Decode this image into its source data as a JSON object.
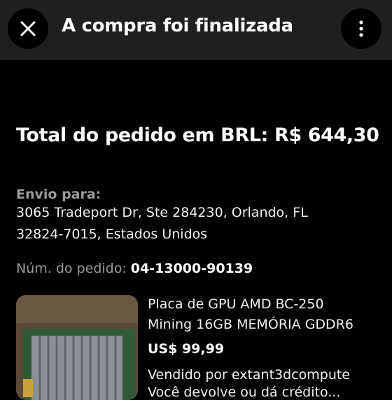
{
  "header": {
    "title": "A compra foi finalizada",
    "close_icon": "close-icon",
    "more_icon": "more-vertical-icon"
  },
  "order": {
    "total_text": "Total do pedido em BRL: R$ 644,30",
    "ship_label": "Envio para:",
    "address_line1": "3065 Tradeport Dr, Ste 284230, Orlando, FL",
    "address_line2": "32824-7015, Estados Unidos",
    "order_number_label": "Núm. do pedido:",
    "order_number": "04-13000-90139"
  },
  "item": {
    "title_line1": "Placa de GPU AMD BC-250",
    "title_line2": "Mining 16GB MEMÓRIA GDDR6",
    "price": "US$ 99,99",
    "seller": "Vendido por extant3dcompute",
    "next_line_partial": "Você devolve ou dá crédito..."
  }
}
